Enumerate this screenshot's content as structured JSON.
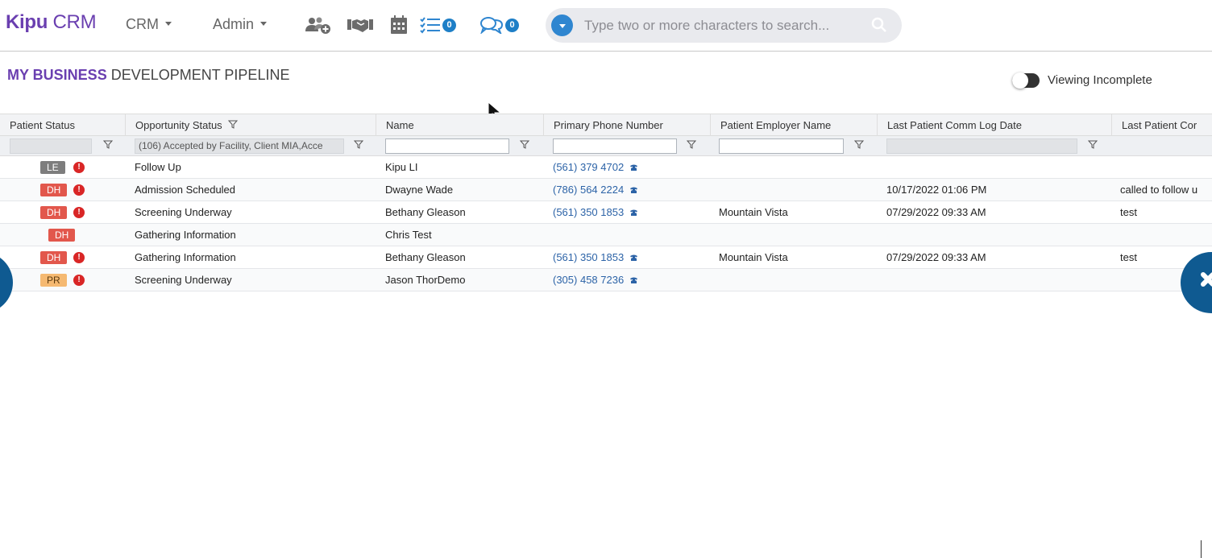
{
  "brand": {
    "bold": "Kipu",
    "light": "CRM"
  },
  "nav": {
    "crm_label": "CRM",
    "admin_label": "Admin",
    "tasks_count": "0",
    "messages_count": "0"
  },
  "search": {
    "placeholder": "Type two or more characters to search..."
  },
  "page": {
    "title_strong": "MY BUSINESS",
    "title_rest": "DEVELOPMENT PIPELINE",
    "toggle_label": "Viewing Incomplete"
  },
  "columns": [
    "Patient Status",
    "Opportunity Status",
    "Name",
    "Primary Phone Number",
    "Patient Employer Name",
    "Last Patient Comm Log Date",
    "Last Patient Cor"
  ],
  "filters": {
    "opportunity_status": "(106) Accepted by Facility, Client MIA,Acce"
  },
  "status_colors": {
    "LE": "#7d7d7d",
    "DH": "#e2574c",
    "PR": "#f5b971"
  },
  "rows": [
    {
      "status": "LE",
      "alert": true,
      "opportunity": "Follow Up",
      "name": "Kipu LI",
      "phone": "(561) 379 4702",
      "employer": "",
      "last_date": "",
      "last_comm": ""
    },
    {
      "status": "DH",
      "alert": true,
      "opportunity": "Admission Scheduled",
      "name": "Dwayne Wade",
      "phone": "(786) 564 2224",
      "employer": "",
      "last_date": "10/17/2022 01:06 PM",
      "last_comm": "called to follow u"
    },
    {
      "status": "DH",
      "alert": true,
      "opportunity": "Screening Underway",
      "name": "Bethany Gleason",
      "phone": "(561) 350 1853",
      "employer": "Mountain Vista",
      "last_date": "07/29/2022 09:33 AM",
      "last_comm": "test"
    },
    {
      "status": "DH",
      "alert": false,
      "opportunity": "Gathering Information",
      "name": "Chris Test",
      "phone": "",
      "employer": "",
      "last_date": "",
      "last_comm": ""
    },
    {
      "status": "DH",
      "alert": true,
      "opportunity": "Gathering Information",
      "name": "Bethany Gleason",
      "phone": "(561) 350 1853",
      "employer": "Mountain Vista",
      "last_date": "07/29/2022 09:33 AM",
      "last_comm": "test"
    },
    {
      "status": "PR",
      "alert": true,
      "opportunity": "Screening Underway",
      "name": "Jason ThorDemo",
      "phone": "(305) 458 7236",
      "employer": "",
      "last_date": "",
      "last_comm": ""
    }
  ],
  "icons": {
    "add_user": "add-user-icon",
    "handshake": "handshake-icon",
    "calendar": "calendar-icon",
    "tasks": "task-list-icon",
    "messages": "chat-icon",
    "search": "magnifier-icon",
    "phone": "phone-icon",
    "filter": "funnel-icon",
    "alert": "alert-icon"
  }
}
